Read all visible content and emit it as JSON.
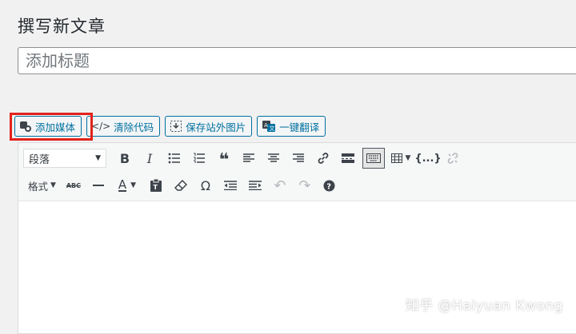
{
  "page": {
    "title": "撰写新文章"
  },
  "title_field": {
    "placeholder": "添加标题"
  },
  "media_buttons": [
    {
      "label": "添加媒体",
      "icon": "media-icon"
    },
    {
      "label": "清除代码",
      "icon": "code-icon"
    },
    {
      "label": "保存站外图片",
      "icon": "save-image-icon"
    },
    {
      "label": "一键翻译",
      "icon": "translate-icon"
    }
  ],
  "toolbar": {
    "format_select": "段落",
    "format_menu": "格式",
    "strike_label": "ABC",
    "bold": "B",
    "italic": "I",
    "text_color": "A",
    "special_char": "Ω"
  },
  "watermark": "知乎 @Haiyuan Kwong",
  "colors": {
    "accent": "#0071a1",
    "highlight": "#e2231a",
    "background": "#f1f1f1"
  }
}
